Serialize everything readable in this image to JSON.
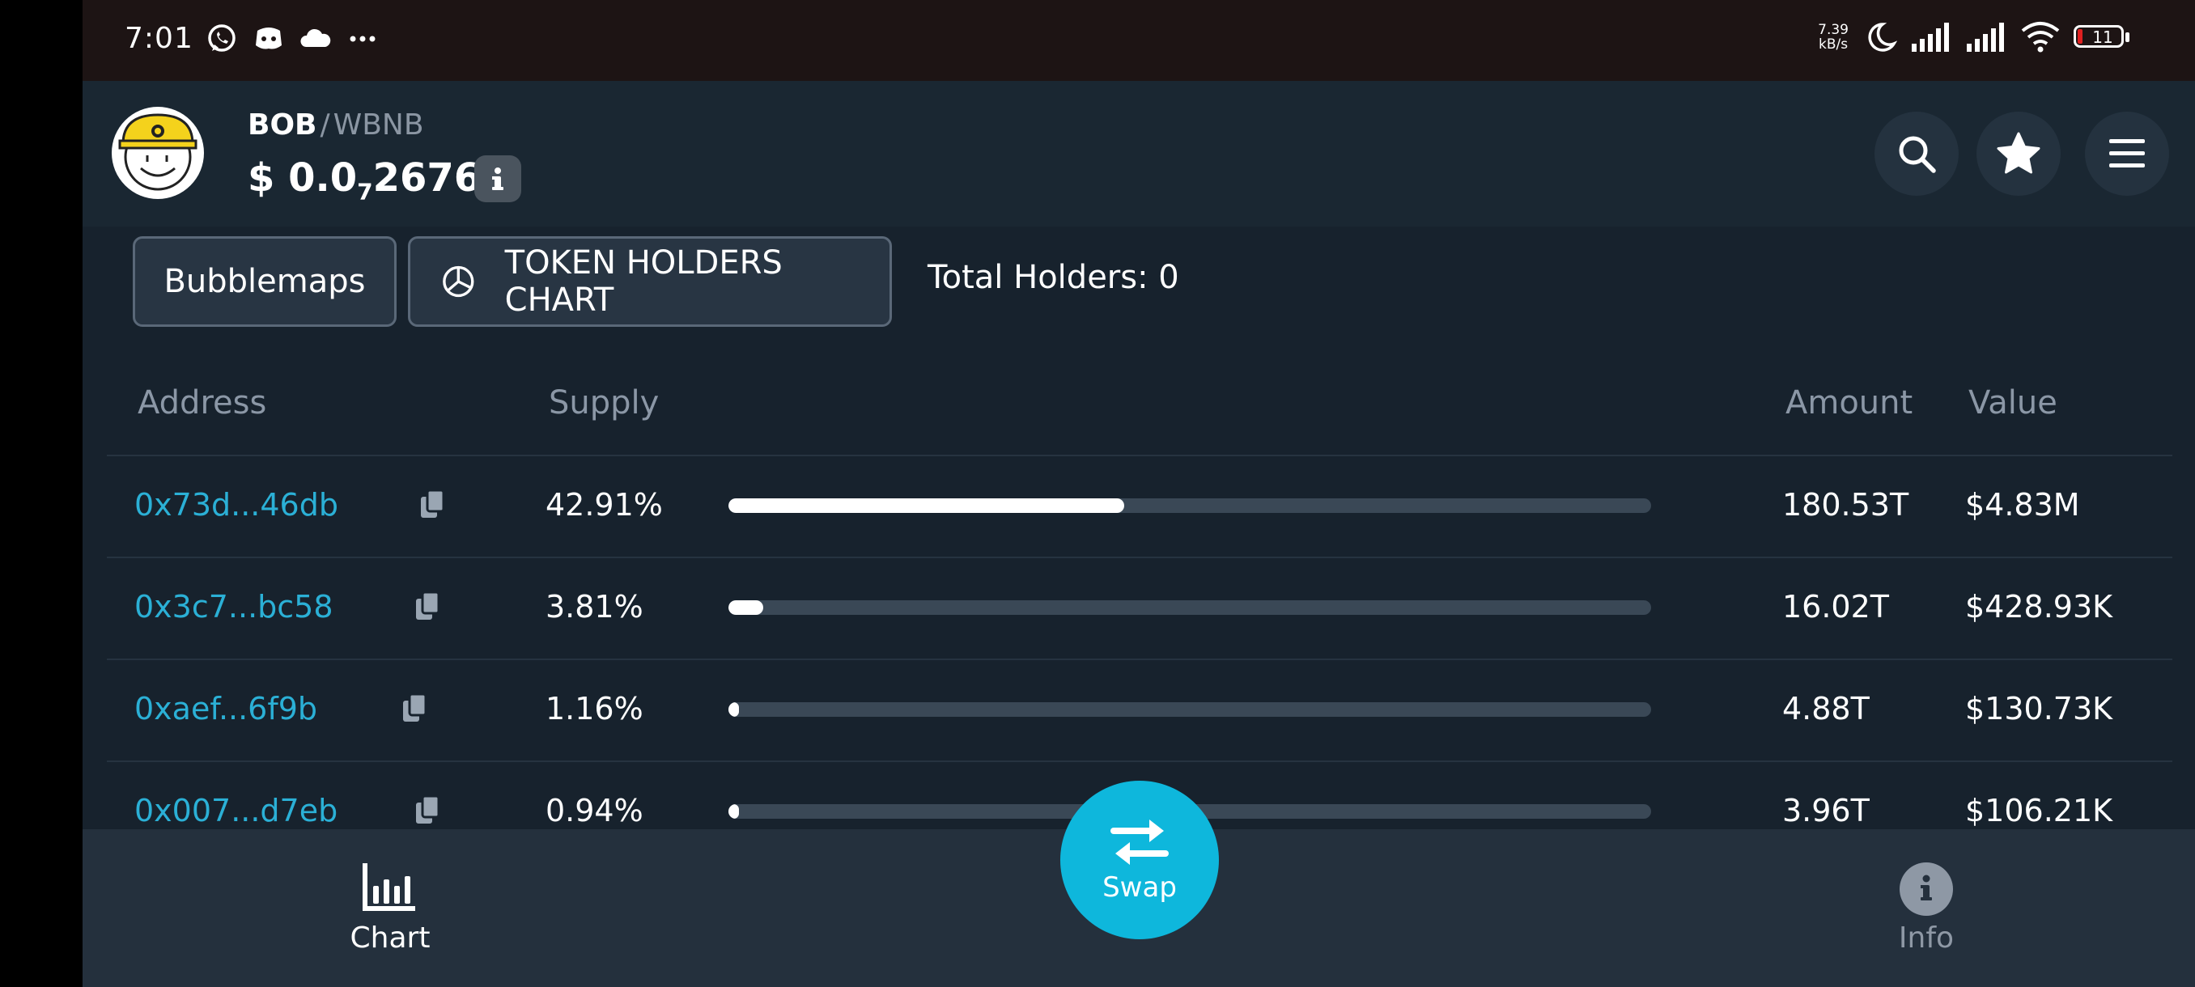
{
  "status_bar": {
    "time": "7:01",
    "net_speed_value": "7.39",
    "net_speed_unit": "kB/s",
    "battery": "11"
  },
  "header": {
    "base_token": "BOB",
    "separator": "/",
    "quote_token": "WBNB",
    "price_prefix": "$ 0.0",
    "price_zeros": "7",
    "price_digits": "2676"
  },
  "toolbar": {
    "bubblemaps_label": "Bubblemaps",
    "holders_chart_label": "TOKEN HOLDERS CHART",
    "total_holders": "Total Holders: 0"
  },
  "table": {
    "headers": [
      "Address",
      "Supply",
      "Amount",
      "Value"
    ],
    "rows": [
      {
        "address": "0x73d...46db",
        "supply": "42.91%",
        "supply_fraction": 0.4291,
        "amount": "180.53T",
        "value": "$4.83M"
      },
      {
        "address": "0x3c7...bc58",
        "supply": "3.81%",
        "supply_fraction": 0.0381,
        "amount": "16.02T",
        "value": "$428.93K"
      },
      {
        "address": "0xaef...6f9b",
        "supply": "1.16%",
        "supply_fraction": 0.0116,
        "amount": "4.88T",
        "value": "$130.73K"
      },
      {
        "address": "0x007...d7eb",
        "supply": "0.94%",
        "supply_fraction": 0.0094,
        "amount": "3.96T",
        "value": "$106.21K"
      }
    ]
  },
  "bottom_nav": {
    "chart_label": "Chart",
    "swap_label": "Swap",
    "info_label": "Info"
  },
  "colors": {
    "accent": "#0eb7dc",
    "address_link": "#2bb0d6",
    "background": "#17222d"
  }
}
